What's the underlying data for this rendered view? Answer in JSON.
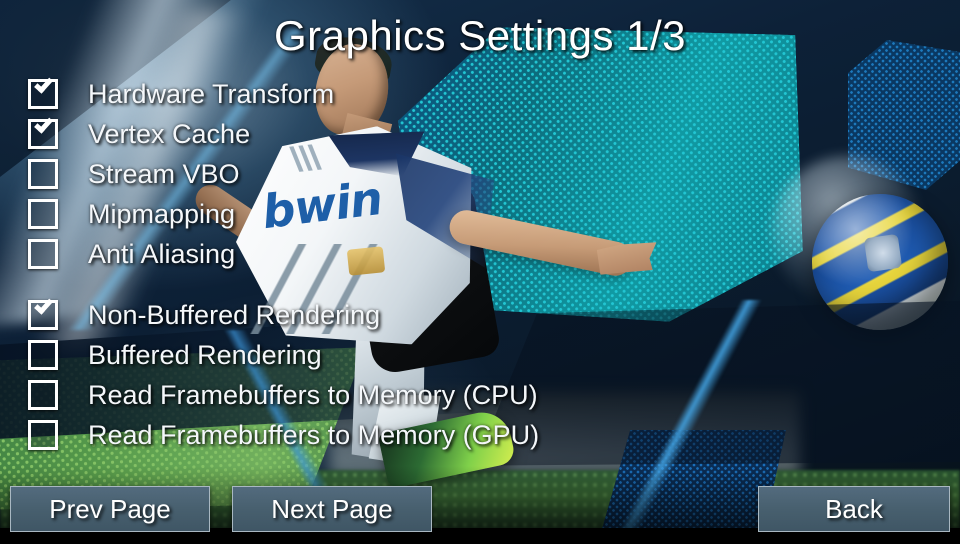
{
  "screen": {
    "title": "Graphics Settings 1/3",
    "page_indicator": "1/3"
  },
  "option_groups": [
    {
      "name": "rendering-features",
      "options": [
        {
          "label": "Hardware Transform",
          "checked": true
        },
        {
          "label": "Vertex Cache",
          "checked": true
        },
        {
          "label": "Stream VBO",
          "checked": false
        },
        {
          "label": "Mipmapping",
          "checked": false
        },
        {
          "label": "Anti Aliasing",
          "checked": false
        }
      ]
    },
    {
      "name": "buffering-mode",
      "options": [
        {
          "label": "Non-Buffered Rendering",
          "checked": true
        },
        {
          "label": "Buffered Rendering",
          "checked": false
        },
        {
          "label": "Read Framebuffers to Memory (CPU)",
          "checked": false
        },
        {
          "label": "Read Framebuffers to Memory (GPU)",
          "checked": false
        }
      ]
    }
  ],
  "buttons": {
    "prev": "Prev Page",
    "next": "Next Page",
    "back": "Back"
  },
  "colors": {
    "text": "#f4f7fa",
    "button_face": "#48606f",
    "button_border": "#a9b8c2",
    "checkbox_border": "#ffffff",
    "hex_panel_teal": "#109aa3",
    "pitch_green": "#63ab52",
    "ball_blue": "#1a4fa0",
    "ball_yellow": "#e8d63c"
  },
  "background": {
    "description_elements": [
      "stadium-light-rays",
      "teal-halftone-hexagon-panel",
      "blue-halftone-hexagon-panel",
      "green-halftone-pitch-panel",
      "soccer-player-figure",
      "soccer-ball"
    ]
  }
}
